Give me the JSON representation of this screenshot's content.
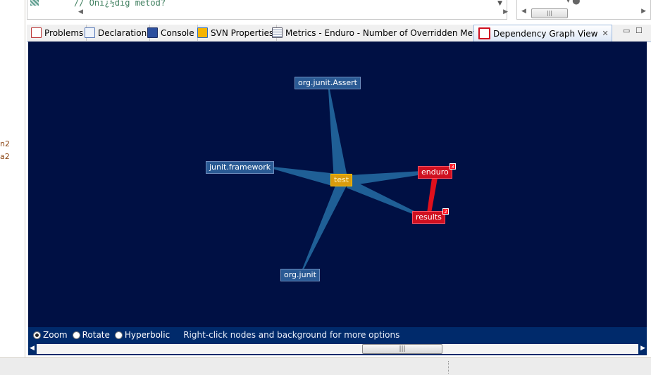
{
  "left_panel": {
    "labels": [
      "n2",
      "a2"
    ]
  },
  "editor": {
    "code_line": "// Oni¿½dig metod?"
  },
  "tabs": [
    {
      "label": "Problems",
      "icon": "problems-icon",
      "active": false
    },
    {
      "label": "Declaration",
      "icon": "declaration-icon",
      "active": false
    },
    {
      "label": "Console",
      "icon": "console-icon",
      "active": false
    },
    {
      "label": "SVN Properties",
      "icon": "svn-properties-icon",
      "active": false
    },
    {
      "label": "Metrics - Enduro - Number of Overridden Method",
      "icon": "metrics-icon",
      "active": false
    },
    {
      "label": "Dependency Graph View",
      "icon": "dependency-graph-icon",
      "active": true,
      "close": "✕"
    }
  ],
  "graph": {
    "background": "#001044",
    "nodes": {
      "assert": {
        "label": "org.junit.Assert"
      },
      "framework": {
        "label": "junit.framework"
      },
      "test": {
        "label": "test"
      },
      "enduro": {
        "label": "enduro",
        "badge": "3"
      },
      "results": {
        "label": "results",
        "badge": "2"
      },
      "junit": {
        "label": "org.junit"
      }
    }
  },
  "controls": {
    "modes": [
      {
        "label": "Zoom",
        "checked": true
      },
      {
        "label": "Rotate",
        "checked": false
      },
      {
        "label": "Hyperbolic",
        "checked": false
      }
    ],
    "hint": "Right-click nodes and background for more options"
  }
}
